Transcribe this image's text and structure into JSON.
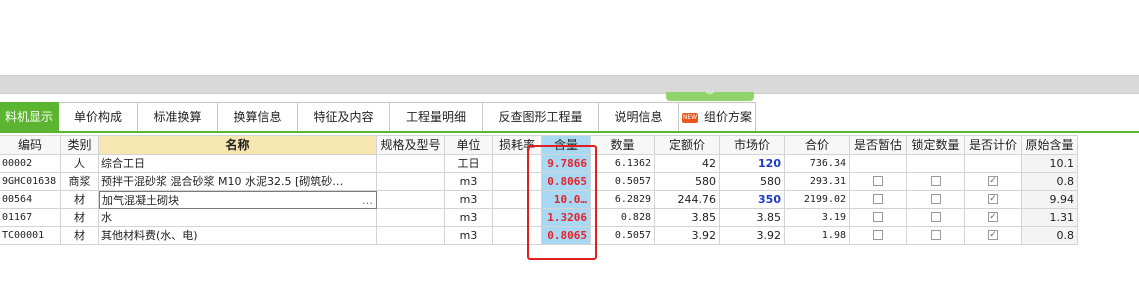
{
  "tabs": [
    {
      "label": "料机显示",
      "active": true
    },
    {
      "label": "单价构成"
    },
    {
      "label": "标准换算"
    },
    {
      "label": "换算信息"
    },
    {
      "label": "特征及内容"
    },
    {
      "label": "工程量明细"
    },
    {
      "label": "反查图形工程量"
    },
    {
      "label": "说明信息"
    },
    {
      "label": "组价方案",
      "badge": "NEW"
    }
  ],
  "columns": {
    "code": "编码",
    "type": "类别",
    "name": "名称",
    "spec": "规格及型号",
    "unit": "单位",
    "loss": "损耗率",
    "content": "含量",
    "qty": "数量",
    "quota_price": "定额价",
    "market_price": "市场价",
    "total": "合价",
    "is_estimate": "是否暂估",
    "locked_qty": "锁定数量",
    "is_priced": "是否计价",
    "orig_content": "原始含量"
  },
  "rows": [
    {
      "code": "00002",
      "type": "人",
      "name": "综合工日",
      "spec": "",
      "unit": "工日",
      "loss": "",
      "content": "9.7866",
      "qty": "6.1362",
      "quota_price": "42",
      "market_price": "120",
      "market_highlight": true,
      "total": "736.34",
      "estimate_cb": false,
      "locked_cb": false,
      "priced_cb": false,
      "orig": "10.1"
    },
    {
      "code": "9GHC01638",
      "type": "商浆",
      "name": "预拌干混砂浆 混合砂浆 M10 水泥32.5 [砌筑砂…",
      "spec": "",
      "unit": "m3",
      "loss": "",
      "content": "0.8065",
      "qty": "0.5057",
      "quota_price": "580",
      "market_price": "580",
      "market_highlight": false,
      "total": "293.31",
      "estimate_cb": true,
      "locked_cb": true,
      "priced_cb": true,
      "orig": "0.8"
    },
    {
      "code": "00564",
      "type": "材",
      "name": "加气混凝土砌块",
      "spec": "",
      "unit": "m3",
      "loss": "",
      "content": "10.0…",
      "qty": "6.2829",
      "quota_price": "244.76",
      "market_price": "350",
      "market_highlight": true,
      "total": "2199.02",
      "estimate_cb": true,
      "locked_cb": true,
      "priced_cb": true,
      "orig": "9.94",
      "name_editing": true,
      "more": "…"
    },
    {
      "code": "01167",
      "type": "材",
      "name": "水",
      "spec": "",
      "unit": "m3",
      "loss": "",
      "content": "1.3206",
      "qty": "0.828",
      "quota_price": "3.85",
      "market_price": "3.85",
      "market_highlight": false,
      "total": "3.19",
      "estimate_cb": true,
      "locked_cb": true,
      "priced_cb": true,
      "orig": "1.31"
    },
    {
      "code": "TC00001",
      "type": "材",
      "name": "其他材料费(水、电)",
      "spec": "",
      "unit": "m3",
      "loss": "",
      "content": "0.8065",
      "qty": "0.5057",
      "quota_price": "3.92",
      "market_price": "3.92",
      "market_highlight": false,
      "total": "1.98",
      "estimate_cb": true,
      "locked_cb": true,
      "priced_cb": true,
      "orig": "0.8"
    }
  ],
  "check_mark": "✓",
  "handle_glyph": "︾",
  "colors": {
    "accent": "#5cb531",
    "highlight": "#a9d8f2",
    "red": "#e8202a",
    "blue": "#1a3cc8"
  }
}
